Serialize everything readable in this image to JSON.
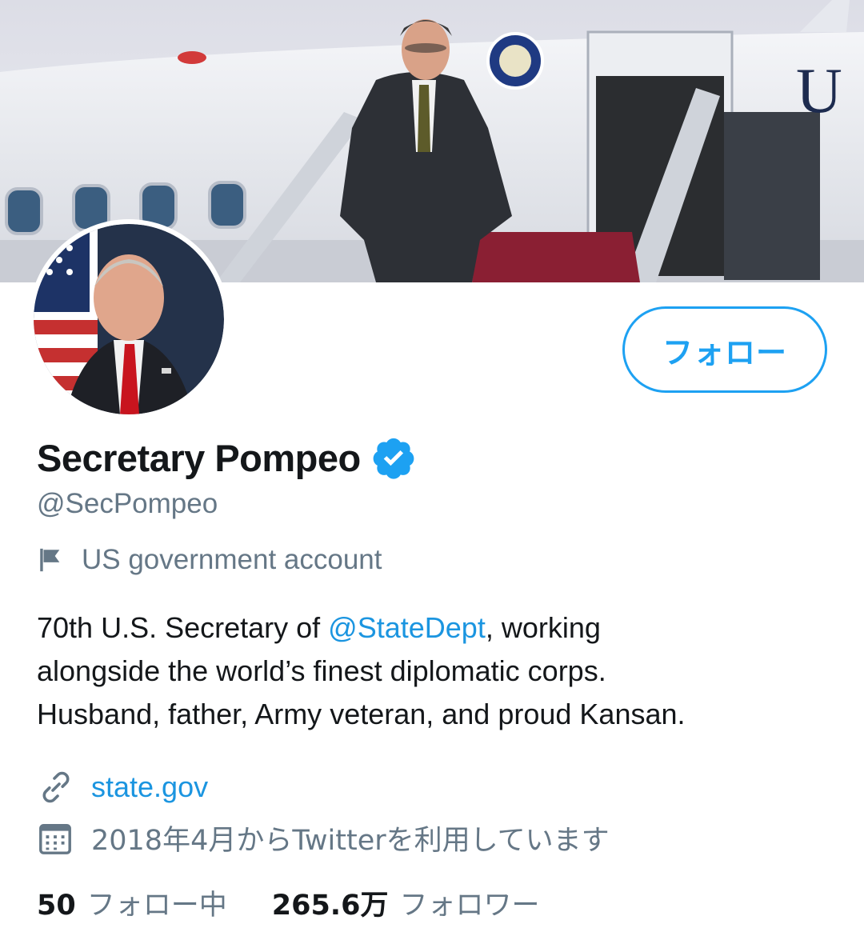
{
  "profile": {
    "display_name": "Secretary Pompeo",
    "handle": "@SecPompeo",
    "account_type": "US government account",
    "bio_prefix": "70th U.S. Secretary of ",
    "bio_mention": "@StateDept",
    "bio_line1_suffix": ", working",
    "bio_line2": "alongside the world’s finest diplomatic corps.",
    "bio_line3": "Husband, father, Army veteran, and proud Kansan.",
    "website": "state.gov",
    "joined": "2018年4月からTwitterを利用しています"
  },
  "follow_button": {
    "label": "フォロー"
  },
  "stats": {
    "following_count": "50",
    "following_label": "フォロー中",
    "followers_count": "265.6万",
    "followers_label": "フォロワー"
  },
  "icons": {
    "verified": "verified-badge-icon",
    "account_type": "flag-icon",
    "website": "link-icon",
    "joined": "calendar-icon"
  },
  "colors": {
    "accent": "#1da1f2",
    "link": "#1b95e0",
    "secondary_text": "#657786",
    "primary_text": "#14171a"
  }
}
